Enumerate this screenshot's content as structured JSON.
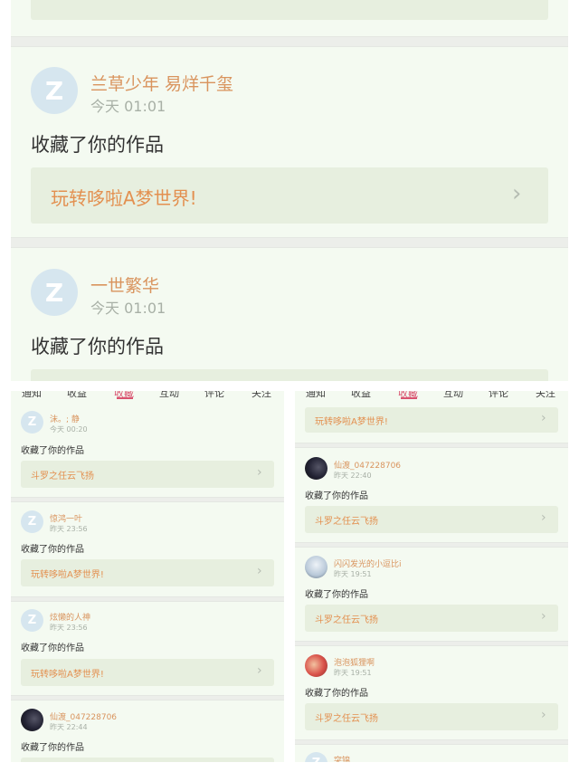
{
  "tabs": [
    "通知",
    "收益",
    "收藏",
    "互动",
    "评论",
    "关注"
  ],
  "active_tab_index": 2,
  "accent_color": "#d9526f",
  "name_color": "#d9945e",
  "card_title_color": "#e39050",
  "top": {
    "items": [
      {
        "name": "兰草少年 易烊千玺",
        "time": "今天 01:01",
        "action": "收藏了你的作品",
        "work": "玩转哆啦A梦世界!"
      },
      {
        "name": "一世繁华",
        "time": "今天 01:01",
        "action": "收藏了你的作品"
      }
    ]
  },
  "left": {
    "items": [
      {
        "name": "沫。; 静",
        "time": "今天 00:20",
        "action": "收藏了你的作品",
        "work": "斗罗之任云飞扬"
      },
      {
        "name": "惊鸿一叶",
        "time": "昨天 23:56",
        "action": "收藏了你的作品",
        "work": "玩转哆啦A梦世界!"
      },
      {
        "name": "炫懒的人神",
        "time": "昨天 23:56",
        "action": "收藏了你的作品",
        "work": "玩转哆啦A梦世界!"
      },
      {
        "name": "仙渡_047228706",
        "time": "昨天 22:44",
        "action": "收藏了你的作品"
      }
    ]
  },
  "right": {
    "first_work": "玩转哆啦A梦世界!",
    "items": [
      {
        "name": "仙渡_047228706",
        "time": "昨天 22:40",
        "action": "收藏了你的作品",
        "work": "斗罗之任云飞扬"
      },
      {
        "name": "闪闪发光的小逗比i",
        "time": "昨天 19:51",
        "action": "收藏了你的作品",
        "work": "斗罗之任云飞扬"
      },
      {
        "name": "泡泡狐狸啊",
        "time": "昨天 19:51",
        "action": "收藏了你的作品",
        "work": "斗罗之任云飞扬"
      },
      {
        "name": "突锦"
      }
    ]
  }
}
